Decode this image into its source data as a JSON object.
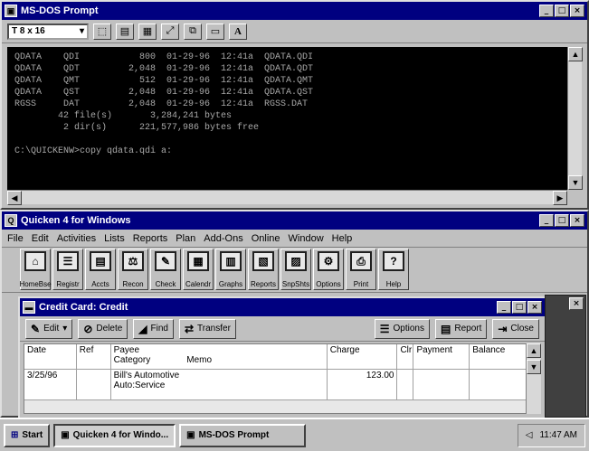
{
  "dos_window": {
    "title": "MS-DOS Prompt",
    "font_size": "8 x 16",
    "toolbar_letter": "A",
    "lines": [
      "QDATA    QDI           800  01-29-96  12:41a  QDATA.QDI",
      "QDATA    QDT         2,048  01-29-96  12:41a  QDATA.QDT",
      "QDATA    QMT           512  01-29-96  12:41a  QDATA.QMT",
      "QDATA    QST         2,048  01-29-96  12:41a  QDATA.QST",
      "RGSS     DAT         2,048  01-29-96  12:41a  RGSS.DAT",
      "        42 file(s)       3,284,241 bytes",
      "         2 dir(s)      221,577,986 bytes free",
      "",
      "C:\\QUICKENW>copy qdata.qdi a:"
    ]
  },
  "quicken_window": {
    "title": "Quicken 4 for Windows",
    "menu": [
      "File",
      "Edit",
      "Activities",
      "Lists",
      "Reports",
      "Plan",
      "Add-Ons",
      "Online",
      "Window",
      "Help"
    ],
    "iconbar": [
      {
        "label": "HomeBse",
        "icon": "home-icon",
        "glyph": "⌂"
      },
      {
        "label": "Registr",
        "icon": "register-icon",
        "glyph": "☰"
      },
      {
        "label": "Accts",
        "icon": "accounts-icon",
        "glyph": "▤"
      },
      {
        "label": "Recon",
        "icon": "reconcile-icon",
        "glyph": "⚖"
      },
      {
        "label": "Check",
        "icon": "check-icon",
        "glyph": "✎"
      },
      {
        "label": "Calendr",
        "icon": "calendar-icon",
        "glyph": "▦"
      },
      {
        "label": "Graphs",
        "icon": "graphs-icon",
        "glyph": "▥"
      },
      {
        "label": "Reports",
        "icon": "reports-icon",
        "glyph": "▧"
      },
      {
        "label": "SnpShts",
        "icon": "snapshots-icon",
        "glyph": "▨"
      },
      {
        "label": "Options",
        "icon": "options-icon",
        "glyph": "⚙"
      },
      {
        "label": "Print",
        "icon": "print-icon",
        "glyph": "⎙"
      },
      {
        "label": "Help",
        "icon": "help-icon",
        "glyph": "?"
      }
    ]
  },
  "register": {
    "title": "Credit Card: Credit",
    "toolbar": {
      "edit": "Edit",
      "delete": "Delete",
      "find": "Find",
      "transfer": "Transfer",
      "options": "Options",
      "report": "Report",
      "close": "Close"
    },
    "headers": {
      "date": "Date",
      "ref": "Ref",
      "payee": "Payee",
      "category": "Category",
      "memo": "Memo",
      "charge": "Charge",
      "clr": "Clr",
      "payment": "Payment",
      "balance": "Balance"
    },
    "rows": [
      {
        "date": "3/25/96",
        "ref": "",
        "payee": "Bill's Automotive",
        "category": "Auto:Service",
        "charge": "123.00",
        "payment": "",
        "balance": ""
      }
    ]
  },
  "taskbar": {
    "start": "Start",
    "items": [
      "Quicken 4 for Windo...",
      "MS-DOS Prompt"
    ],
    "clock": "11:47 AM"
  }
}
